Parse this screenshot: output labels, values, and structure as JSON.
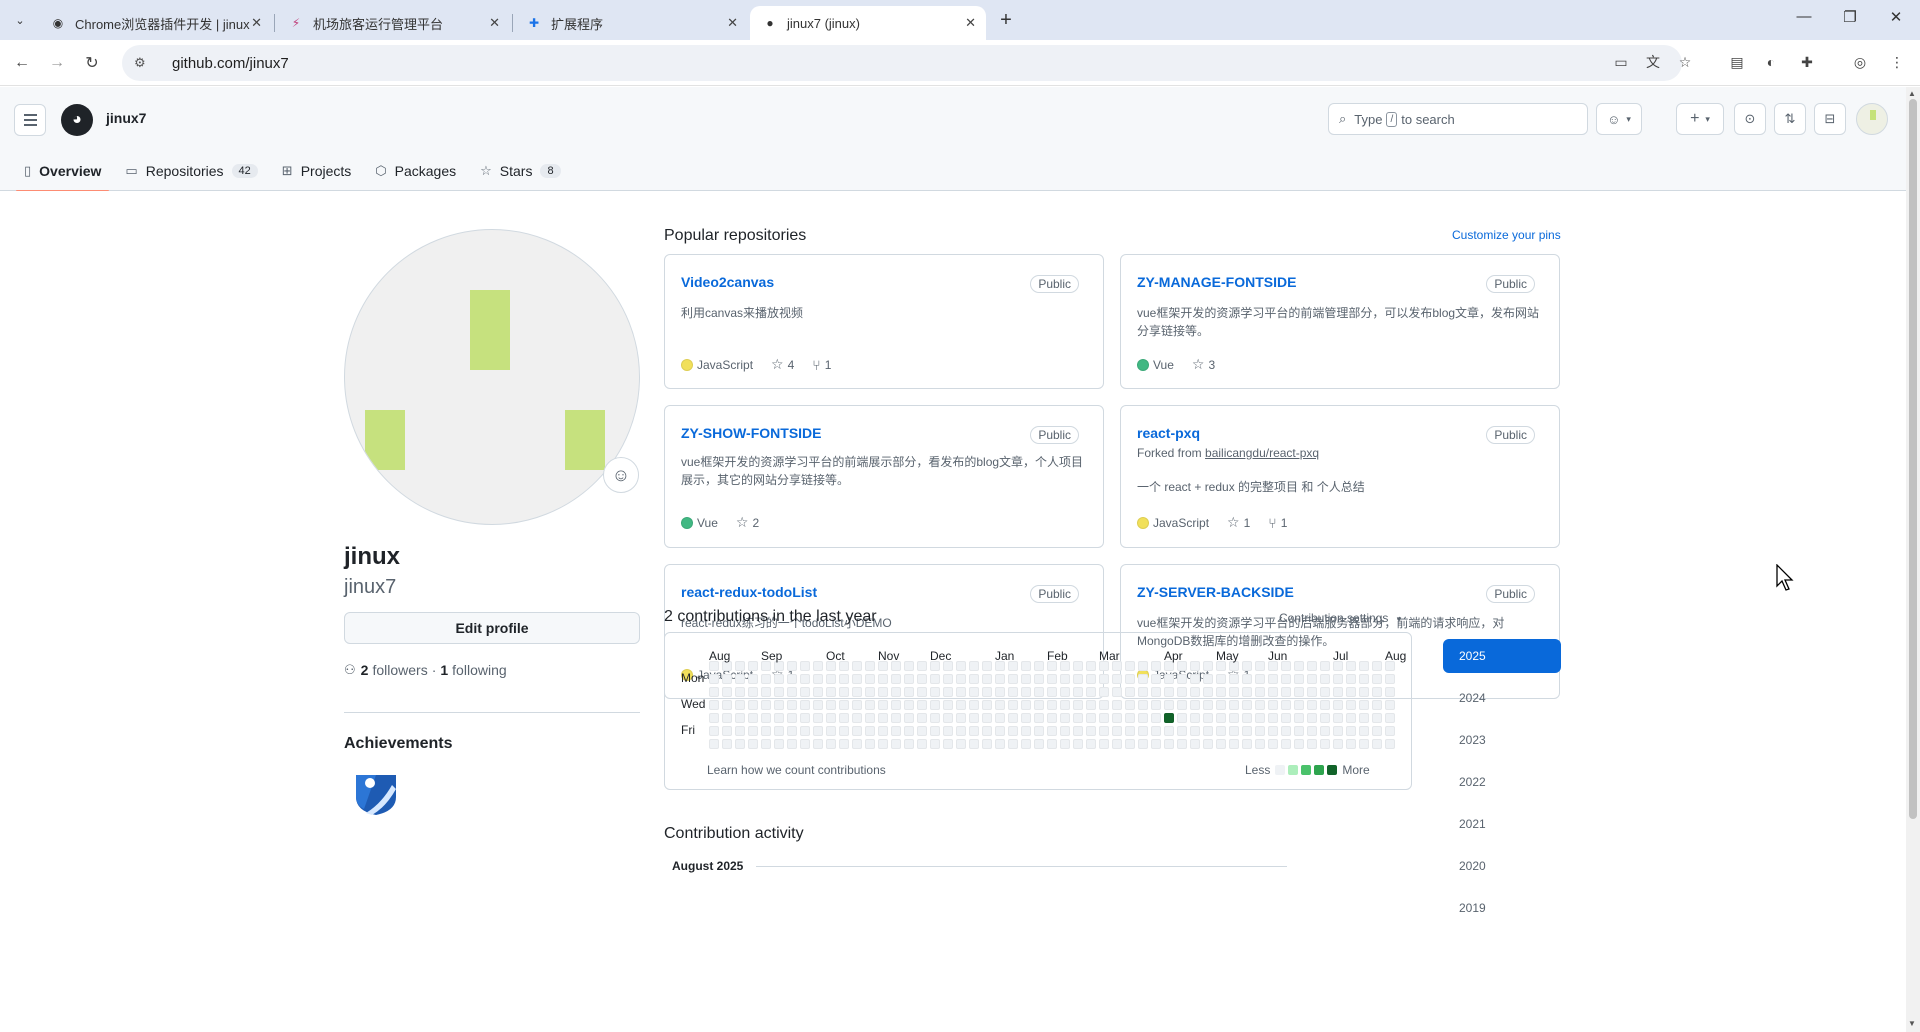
{
  "browser": {
    "tabs": [
      {
        "title": "Chrome浏览器插件开发 | jinux",
        "icon": "globe-icon"
      },
      {
        "title": "机场旅客运行管理平台",
        "icon": "app-icon"
      },
      {
        "title": "扩展程序",
        "icon": "puzzle-icon"
      },
      {
        "title": "jinux7 (jinux)",
        "icon": "github-icon"
      }
    ],
    "url": "github.com/jinux7"
  },
  "header": {
    "username": "jinux7",
    "search_prefix": "Type",
    "search_key": "/",
    "search_suffix": "to search"
  },
  "nav": {
    "tabs": [
      {
        "label": "Overview",
        "icon": "book-icon",
        "count": ""
      },
      {
        "label": "Repositories",
        "icon": "repo-icon",
        "count": "42"
      },
      {
        "label": "Projects",
        "icon": "table-icon",
        "count": ""
      },
      {
        "label": "Packages",
        "icon": "package-icon",
        "count": ""
      },
      {
        "label": "Stars",
        "icon": "star-icon",
        "count": "8"
      }
    ]
  },
  "profile": {
    "name": "jinux",
    "login": "jinux7",
    "edit_label": "Edit profile",
    "followers": "2",
    "followers_label": "followers",
    "separator": "·",
    "following": "1",
    "following_label": "following",
    "achievements_title": "Achievements"
  },
  "pinned": {
    "title": "Popular repositories",
    "customize": "Customize your pins",
    "repos": [
      {
        "name": "Video2canvas",
        "visibility": "Public",
        "forked_prefix": "",
        "forked_from": "",
        "description": "利用canvas来播放视频",
        "language": "JavaScript",
        "lang_color": "#f1e05a",
        "stars": "4",
        "forks": "1"
      },
      {
        "name": "ZY-MANAGE-FONTSIDE",
        "visibility": "Public",
        "forked_prefix": "",
        "forked_from": "",
        "description": "vue框架开发的资源学习平台的前端管理部分，可以发布blog文章，发布网站分享链接等。",
        "language": "Vue",
        "lang_color": "#41b883",
        "stars": "3",
        "forks": ""
      },
      {
        "name": "ZY-SHOW-FONTSIDE",
        "visibility": "Public",
        "forked_prefix": "",
        "forked_from": "",
        "description": "vue框架开发的资源学习平台的前端展示部分，看发布的blog文章，个人项目展示，其它的网站分享链接等。",
        "language": "Vue",
        "lang_color": "#41b883",
        "stars": "2",
        "forks": ""
      },
      {
        "name": "react-pxq",
        "visibility": "Public",
        "forked_prefix": "Forked from",
        "forked_from": "bailicangdu/react-pxq",
        "description": "一个 react + redux 的完整项目 和 个人总结",
        "language": "JavaScript",
        "lang_color": "#f1e05a",
        "stars": "1",
        "forks": "1"
      },
      {
        "name": "react-redux-todoList",
        "visibility": "Public",
        "forked_prefix": "",
        "forked_from": "",
        "description": "react-redux练习的一个todoList小DEMO",
        "language": "JavaScript",
        "lang_color": "#f1e05a",
        "stars": "1",
        "forks": ""
      },
      {
        "name": "ZY-SERVER-BACKSIDE",
        "visibility": "Public",
        "forked_prefix": "",
        "forked_from": "",
        "description": "vue框架开发的资源学习平台的后端服务器部分，前端的请求响应，对MongoDB数据库的增删改查的操作。",
        "language": "JavaScript",
        "lang_color": "#f1e05a",
        "stars": "1",
        "forks": ""
      }
    ]
  },
  "contributions": {
    "title": "2 contributions in the last year",
    "settings": "Contribution settings",
    "months": [
      "Aug",
      "Sep",
      "Oct",
      "Nov",
      "Dec",
      "Jan",
      "Feb",
      "Mar",
      "Apr",
      "May",
      "Jun",
      "Jul",
      "Aug"
    ],
    "days": [
      "Mon",
      "Wed",
      "Fri"
    ],
    "learn": "Learn how we count contributions",
    "legend_less": "Less",
    "legend_more": "More",
    "legend_colors": [
      "#eff2f5",
      "#aceebb",
      "#4ac26b",
      "#2da44e",
      "#116329"
    ],
    "active_cells": [
      {
        "week": 35,
        "day": 4,
        "color": "#116329"
      }
    ],
    "years": [
      "2025",
      "2024",
      "2023",
      "2022",
      "2021",
      "2020",
      "2019"
    ],
    "selected_year": "2025"
  },
  "activity": {
    "title": "Contribution activity",
    "month": "August 2025"
  }
}
